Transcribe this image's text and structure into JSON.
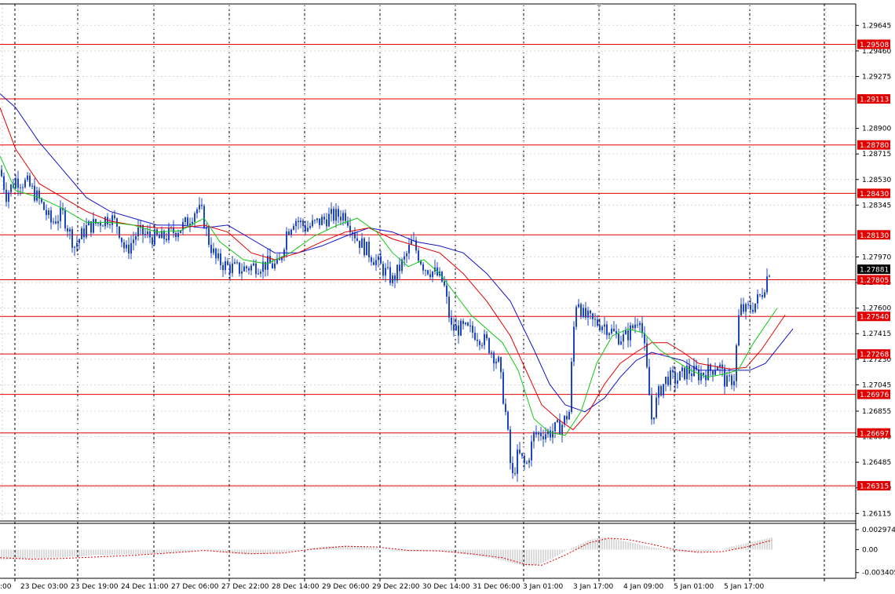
{
  "chart_data": [
    {
      "type": "candlestick",
      "title": "",
      "y_ticks": [
        "1.29645",
        "1.29460",
        "1.29275",
        "1.28900",
        "1.28715",
        "1.28530",
        "1.28345",
        "1.27970",
        "1.27785",
        "1.27600",
        "1.27415",
        "1.27230",
        "1.27045",
        "1.26855",
        "1.26670",
        "1.26485",
        "1.26300",
        "1.26115"
      ],
      "ylim": [
        1.2606,
        1.298
      ],
      "x_ticks": [
        ":00",
        "23 Dec 03:00",
        "23 Dec 19:00",
        "24 Dec 11:00",
        "27 Dec 06:00",
        "27 Dec 22:00",
        "28 Dec 14:00",
        "29 Dec 06:00",
        "29 Dec 22:00",
        "30 Dec 14:00",
        "31 Dec 06:00",
        "3 Jan 01:00",
        "3 Jan 17:00",
        "4 Jan 09:00",
        "5 Jan 01:00",
        "5 Jan 17:00"
      ],
      "current_price": "1.27881",
      "current_price_value": 1.27881,
      "levels": [
        {
          "label": "1.29508",
          "value": 1.29508
        },
        {
          "label": "1.29113",
          "value": 1.29113
        },
        {
          "label": "1.28780",
          "value": 1.2878
        },
        {
          "label": "1.28430",
          "value": 1.2843
        },
        {
          "label": "1.28130",
          "value": 1.2813
        },
        {
          "label": "1.27805",
          "value": 1.27805
        },
        {
          "label": "1.27540",
          "value": 1.2754
        },
        {
          "label": "1.27268",
          "value": 1.27268
        },
        {
          "label": "1.26976",
          "value": 1.26976
        },
        {
          "label": "1.26697",
          "value": 1.26697
        },
        {
          "label": "1.26315",
          "value": 1.26315
        }
      ],
      "price_path": [
        [
          0,
          1.286
        ],
        [
          8,
          1.2842
        ],
        [
          20,
          1.2853
        ],
        [
          35,
          1.285
        ],
        [
          50,
          1.2838
        ],
        [
          65,
          1.2822
        ],
        [
          80,
          1.2828
        ],
        [
          95,
          1.2805
        ],
        [
          110,
          1.2818
        ],
        [
          125,
          1.2822
        ],
        [
          140,
          1.2826
        ],
        [
          150,
          1.282
        ],
        [
          160,
          1.28
        ],
        [
          175,
          1.2815
        ],
        [
          190,
          1.2812
        ],
        [
          205,
          1.281
        ],
        [
          220,
          1.2815
        ],
        [
          235,
          1.282
        ],
        [
          250,
          1.2832
        ],
        [
          258,
          1.2828
        ],
        [
          265,
          1.281
        ],
        [
          275,
          1.2795
        ],
        [
          290,
          1.279
        ],
        [
          305,
          1.2788
        ],
        [
          320,
          1.279
        ],
        [
          340,
          1.2792
        ],
        [
          355,
          1.279
        ],
        [
          365,
          1.2815
        ],
        [
          375,
          1.2825
        ],
        [
          390,
          1.2818
        ],
        [
          405,
          1.2822
        ],
        [
          420,
          1.2826
        ],
        [
          440,
          1.2828
        ],
        [
          455,
          1.281
        ],
        [
          470,
          1.28
        ],
        [
          485,
          1.279
        ],
        [
          500,
          1.278
        ],
        [
          515,
          1.2795
        ],
        [
          525,
          1.2808
        ],
        [
          540,
          1.279
        ],
        [
          555,
          1.2785
        ],
        [
          565,
          1.2778
        ],
        [
          575,
          1.2745
        ],
        [
          590,
          1.2745
        ],
        [
          605,
          1.2742
        ],
        [
          620,
          1.2735
        ],
        [
          635,
          1.272
        ],
        [
          645,
          1.268
        ],
        [
          652,
          1.2635
        ],
        [
          660,
          1.2655
        ],
        [
          670,
          1.2645
        ],
        [
          680,
          1.2668
        ],
        [
          690,
          1.267
        ],
        [
          700,
          1.267
        ],
        [
          715,
          1.2675
        ],
        [
          725,
          1.2685
        ],
        [
          730,
          1.274
        ],
        [
          735,
          1.277
        ],
        [
          742,
          1.2755
        ],
        [
          755,
          1.275
        ],
        [
          770,
          1.2748
        ],
        [
          785,
          1.274
        ],
        [
          795,
          1.2738
        ],
        [
          805,
          1.2745
        ],
        [
          815,
          1.2755
        ],
        [
          822,
          1.2725
        ],
        [
          830,
          1.268
        ],
        [
          840,
          1.27
        ],
        [
          850,
          1.271
        ],
        [
          862,
          1.2708
        ],
        [
          875,
          1.2715
        ],
        [
          890,
          1.2712
        ],
        [
          905,
          1.2715
        ],
        [
          915,
          1.272
        ],
        [
          925,
          1.2705
        ],
        [
          935,
          1.271
        ],
        [
          942,
          1.276
        ],
        [
          950,
          1.2758
        ],
        [
          960,
          1.2762
        ],
        [
          970,
          1.277
        ],
        [
          980,
          1.2788
        ]
      ],
      "ma_fast_path": [
        [
          0,
          1.287
        ],
        [
          20,
          1.2845
        ],
        [
          50,
          1.284
        ],
        [
          80,
          1.2832
        ],
        [
          110,
          1.2822
        ],
        [
          140,
          1.2822
        ],
        [
          170,
          1.282
        ],
        [
          200,
          1.2815
        ],
        [
          230,
          1.2816
        ],
        [
          260,
          1.2825
        ],
        [
          280,
          1.2808
        ],
        [
          310,
          1.2795
        ],
        [
          340,
          1.2792
        ],
        [
          370,
          1.28
        ],
        [
          400,
          1.2812
        ],
        [
          430,
          1.282
        ],
        [
          455,
          1.2825
        ],
        [
          480,
          1.2815
        ],
        [
          500,
          1.28
        ],
        [
          520,
          1.279
        ],
        [
          540,
          1.2795
        ],
        [
          560,
          1.2785
        ],
        [
          580,
          1.277
        ],
        [
          600,
          1.2755
        ],
        [
          620,
          1.2745
        ],
        [
          640,
          1.2735
        ],
        [
          660,
          1.2715
        ],
        [
          680,
          1.268
        ],
        [
          700,
          1.267
        ],
        [
          720,
          1.2668
        ],
        [
          740,
          1.2685
        ],
        [
          760,
          1.272
        ],
        [
          780,
          1.274
        ],
        [
          800,
          1.2745
        ],
        [
          820,
          1.2742
        ],
        [
          840,
          1.273
        ],
        [
          860,
          1.2722
        ],
        [
          880,
          1.2715
        ],
        [
          900,
          1.271
        ],
        [
          920,
          1.2712
        ],
        [
          940,
          1.2715
        ],
        [
          960,
          1.2735
        ],
        [
          990,
          1.276
        ]
      ],
      "ma_mid_path": [
        [
          0,
          1.2905
        ],
        [
          20,
          1.2875
        ],
        [
          50,
          1.285
        ],
        [
          80,
          1.284
        ],
        [
          110,
          1.283
        ],
        [
          140,
          1.2823
        ],
        [
          170,
          1.282
        ],
        [
          200,
          1.2818
        ],
        [
          230,
          1.2818
        ],
        [
          260,
          1.282
        ],
        [
          290,
          1.2815
        ],
        [
          320,
          1.28
        ],
        [
          350,
          1.2795
        ],
        [
          380,
          1.28
        ],
        [
          410,
          1.2808
        ],
        [
          440,
          1.2815
        ],
        [
          470,
          1.2818
        ],
        [
          500,
          1.281
        ],
        [
          530,
          1.2805
        ],
        [
          560,
          1.28
        ],
        [
          590,
          1.2785
        ],
        [
          620,
          1.2765
        ],
        [
          650,
          1.274
        ],
        [
          670,
          1.2715
        ],
        [
          690,
          1.269
        ],
        [
          710,
          1.268
        ],
        [
          730,
          1.2672
        ],
        [
          750,
          1.2685
        ],
        [
          770,
          1.2705
        ],
        [
          790,
          1.272
        ],
        [
          810,
          1.2728
        ],
        [
          830,
          1.2735
        ],
        [
          850,
          1.2735
        ],
        [
          870,
          1.2728
        ],
        [
          890,
          1.272
        ],
        [
          910,
          1.2718
        ],
        [
          930,
          1.2716
        ],
        [
          950,
          1.2717
        ],
        [
          970,
          1.273
        ],
        [
          1000,
          1.2755
        ]
      ],
      "ma_slow_path": [
        [
          0,
          1.2915
        ],
        [
          20,
          1.2905
        ],
        [
          50,
          1.288
        ],
        [
          80,
          1.286
        ],
        [
          110,
          1.284
        ],
        [
          140,
          1.283
        ],
        [
          170,
          1.2825
        ],
        [
          200,
          1.282
        ],
        [
          230,
          1.282
        ],
        [
          260,
          1.2818
        ],
        [
          290,
          1.282
        ],
        [
          320,
          1.281
        ],
        [
          350,
          1.28
        ],
        [
          380,
          1.28
        ],
        [
          410,
          1.2805
        ],
        [
          440,
          1.2812
        ],
        [
          470,
          1.2818
        ],
        [
          500,
          1.2815
        ],
        [
          530,
          1.2808
        ],
        [
          560,
          1.2805
        ],
        [
          590,
          1.28
        ],
        [
          620,
          1.2785
        ],
        [
          650,
          1.2765
        ],
        [
          680,
          1.273
        ],
        [
          700,
          1.2705
        ],
        [
          720,
          1.269
        ],
        [
          745,
          1.2685
        ],
        [
          770,
          1.2695
        ],
        [
          790,
          1.271
        ],
        [
          810,
          1.2722
        ],
        [
          830,
          1.2728
        ],
        [
          850,
          1.2725
        ],
        [
          870,
          1.2722
        ],
        [
          890,
          1.2715
        ],
        [
          910,
          1.2715
        ],
        [
          930,
          1.2715
        ],
        [
          955,
          1.2715
        ],
        [
          975,
          1.272
        ],
        [
          1010,
          1.2745
        ]
      ]
    },
    {
      "type": "bar",
      "y_ticks": [
        "0.002974",
        "0.00",
        "-0.003405"
      ],
      "ylim": [
        -0.00425,
        0.0039
      ],
      "histogram": [
        [
          2,
          -0.0015
        ],
        [
          20,
          -0.0014
        ],
        [
          40,
          -0.0013
        ],
        [
          60,
          -0.0012
        ],
        [
          80,
          -0.0011
        ],
        [
          100,
          -0.001
        ],
        [
          120,
          -0.0008
        ],
        [
          140,
          -0.0008
        ],
        [
          160,
          -0.0007
        ],
        [
          180,
          -0.0007
        ],
        [
          200,
          -0.0006
        ],
        [
          220,
          -0.0005
        ],
        [
          240,
          -0.0003
        ],
        [
          260,
          0.0
        ],
        [
          280,
          -0.0003
        ],
        [
          300,
          -0.0006
        ],
        [
          320,
          -0.0007
        ],
        [
          340,
          -0.0006
        ],
        [
          360,
          -0.0004
        ],
        [
          380,
          -0.0001
        ],
        [
          400,
          0.0003
        ],
        [
          420,
          0.0005
        ],
        [
          440,
          0.0006
        ],
        [
          460,
          0.0005
        ],
        [
          480,
          0.0002
        ],
        [
          500,
          -0.0002
        ],
        [
          520,
          -0.0003
        ],
        [
          540,
          -0.0002
        ],
        [
          560,
          -0.0002
        ],
        [
          580,
          -0.0005
        ],
        [
          600,
          -0.0008
        ],
        [
          620,
          -0.0011
        ],
        [
          640,
          -0.0016
        ],
        [
          660,
          -0.0022
        ],
        [
          675,
          -0.0025
        ],
        [
          690,
          -0.002
        ],
        [
          705,
          -0.0012
        ],
        [
          720,
          -0.0002
        ],
        [
          735,
          0.0006
        ],
        [
          750,
          0.0014
        ],
        [
          765,
          0.0018
        ],
        [
          780,
          0.0016
        ],
        [
          795,
          0.0013
        ],
        [
          810,
          0.0009
        ],
        [
          825,
          0.0005
        ],
        [
          840,
          0.0002
        ],
        [
          855,
          -0.0002
        ],
        [
          870,
          -0.0004
        ],
        [
          885,
          -0.0004
        ],
        [
          900,
          -0.0003
        ],
        [
          915,
          -0.0001
        ],
        [
          930,
          0.0004
        ],
        [
          945,
          0.0008
        ],
        [
          960,
          0.0012
        ],
        [
          975,
          0.0016
        ],
        [
          983,
          0.0018
        ]
      ],
      "signal_path": [
        [
          0,
          -0.0012
        ],
        [
          40,
          -0.0014
        ],
        [
          80,
          -0.0013
        ],
        [
          120,
          -0.0011
        ],
        [
          160,
          -0.0009
        ],
        [
          200,
          -0.0006
        ],
        [
          240,
          -0.0003
        ],
        [
          260,
          -0.0001
        ],
        [
          280,
          -0.0003
        ],
        [
          320,
          -0.0006
        ],
        [
          360,
          -0.0005
        ],
        [
          400,
          0.0001
        ],
        [
          440,
          0.0005
        ],
        [
          480,
          0.0004
        ],
        [
          520,
          -0.0001
        ],
        [
          560,
          -0.0002
        ],
        [
          600,
          -0.0006
        ],
        [
          640,
          -0.0012
        ],
        [
          670,
          -0.0022
        ],
        [
          690,
          -0.0023
        ],
        [
          720,
          -0.0008
        ],
        [
          750,
          0.001
        ],
        [
          775,
          0.0017
        ],
        [
          800,
          0.0015
        ],
        [
          830,
          0.0008
        ],
        [
          860,
          0.0
        ],
        [
          890,
          -0.0004
        ],
        [
          920,
          -0.0003
        ],
        [
          950,
          0.0004
        ],
        [
          983,
          0.0014
        ]
      ]
    }
  ]
}
